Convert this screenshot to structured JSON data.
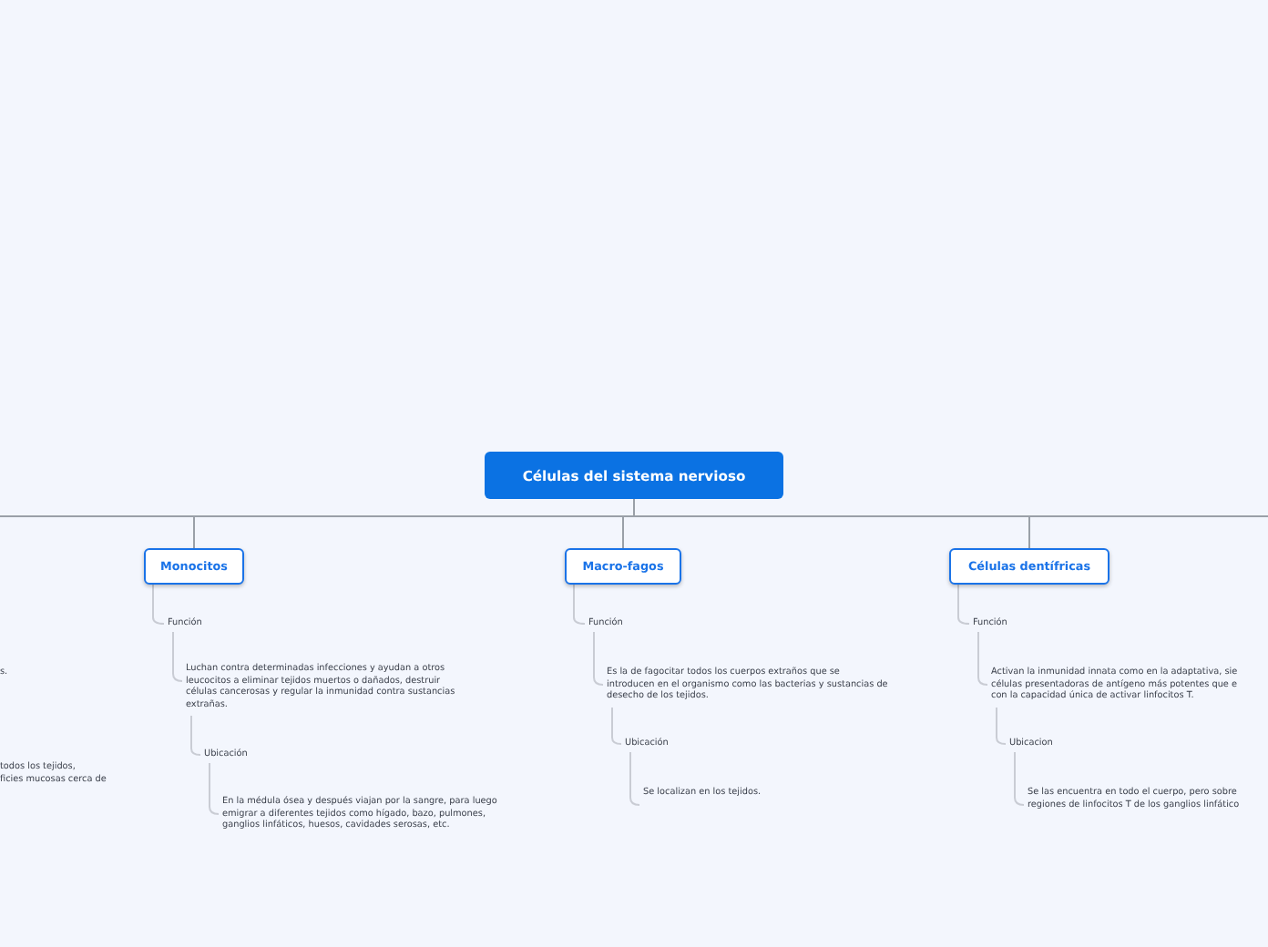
{
  "root": {
    "label": "Células del sistema nervioso"
  },
  "left_fragments": [
    {
      "lines": [
        "s."
      ]
    },
    {
      "lines": [
        "todos los tejidos,",
        "ficies mucosas cerca de"
      ]
    }
  ],
  "branches": [
    {
      "label": "Monocitos",
      "items": [
        {
          "label": "Función",
          "lines": [
            "Luchan contra determinadas infecciones y ayudan a otros",
            "leucocitos a eliminar tejidos muertos o dañados, destruir",
            "células cancerosas y regular la inmunidad contra sustancias",
            "extrañas."
          ]
        },
        {
          "label": "Ubicación",
          "lines": [
            "En la médula ósea y después viajan por la sangre, para luego",
            "emigrar a diferentes tejidos como hígado, bazo, pulmones,",
            "ganglios linfáticos, huesos, cavidades serosas, etc."
          ]
        }
      ]
    },
    {
      "label": "Macro-fagos",
      "items": [
        {
          "label": "Función",
          "lines": [
            "Es la de fagocitar todos los cuerpos extraños que se",
            "introducen en el organismo como las bacterias y sustancias de",
            "desecho de los tejidos."
          ]
        },
        {
          "label": "Ubicación",
          "lines": [
            "Se localizan en los tejidos."
          ]
        }
      ]
    },
    {
      "label": "Células dentífricas",
      "items": [
        {
          "label": "Función",
          "lines": [
            "Activan la inmunidad innata como en la adaptativa, sie",
            "células presentadoras de antígeno más potentes que e",
            "con la capacidad única de activar linfocitos T."
          ]
        },
        {
          "label": "Ubicacion",
          "lines": [
            "Se las encuentra en todo el cuerpo, pero sobre",
            "regiones de linfocitos T de los ganglios linfático"
          ]
        }
      ]
    }
  ]
}
